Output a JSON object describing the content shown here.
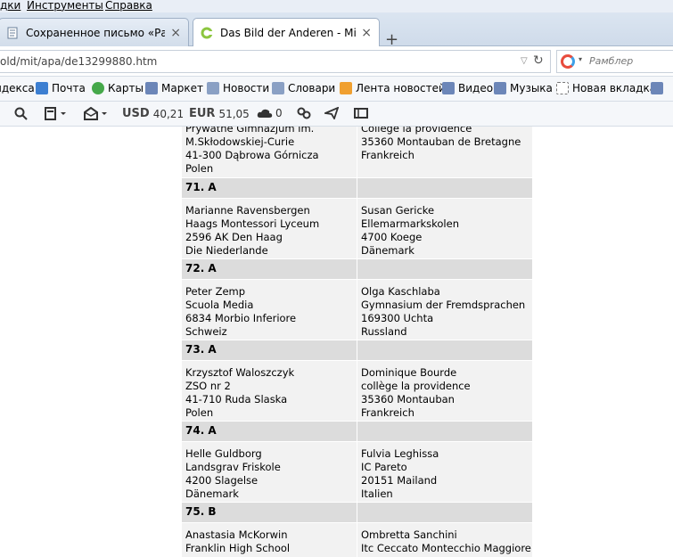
{
  "menubar": {
    "items": [
      "дки",
      "Инструменты",
      "Справка"
    ]
  },
  "tabs": [
    {
      "title": "Сохраненное письмо «Ра...",
      "close": "×"
    },
    {
      "title": "Das Bild der Anderen - Mit...",
      "close": "×"
    }
  ],
  "newtab_label": "+",
  "address": {
    "url": "old/mit/apa/de13299880.htm",
    "dropdown": "▽",
    "reload": "↻"
  },
  "search": {
    "placeholder": "Рамблер",
    "arrow": "▾"
  },
  "bookmarks": [
    {
      "label": "ндекса",
      "color": "#d9d9d9"
    },
    {
      "label": "Почта",
      "color": "#3d7fd1"
    },
    {
      "label": "Карты",
      "color": "#45a84a"
    },
    {
      "label": "Маркет",
      "color": "#6c86b8"
    },
    {
      "label": "Новости",
      "color": "#8aa0c4"
    },
    {
      "label": "Словари",
      "color": "#8aa0c4"
    },
    {
      "label": "Лента новостей",
      "color": "#f0a030"
    },
    {
      "label": "Видео",
      "color": "#6c86b8"
    },
    {
      "label": "Музыка",
      "color": "#6c86b8"
    },
    {
      "label": "Новая вкладка",
      "color": "#ffffff"
    }
  ],
  "toolbar": {
    "usd_label": "USD",
    "usd_value": "40,21",
    "eur_label": "EUR",
    "eur_value": "51,05",
    "weather_value": "0"
  },
  "entries": [
    {
      "header": null,
      "left": [
        "Prywatne Gimnazjum im.",
        "M.Skłodowskiej-Curie",
        "41-300 Dąbrowa Górnicza",
        "Polen"
      ],
      "right": [
        "College la providence",
        "35360 Montauban de Bretagne",
        "Frankreich"
      ]
    },
    {
      "header": "71. A",
      "left": [
        "Marianne Ravensbergen",
        "Haags Montessori Lyceum",
        "2596 AK Den Haag",
        "Die Niederlande"
      ],
      "right": [
        "Susan Gericke",
        "Ellemarmarkskolen",
        "4700 Koege",
        "Dänemark"
      ]
    },
    {
      "header": "72. A",
      "left": [
        "Peter Zemp",
        "Scuola Media",
        "6834 Morbio Inferiore",
        "Schweiz"
      ],
      "right": [
        "Olga Kaschlaba",
        "Gymnasium der Fremdsprachen",
        "169300 Uchta",
        "Russland"
      ]
    },
    {
      "header": "73. A",
      "left": [
        "Krzysztof Waloszczyk",
        "ZSO nr 2",
        "41-710 Ruda Slaska",
        "Polen"
      ],
      "right": [
        "Dominique Bourde",
        "collège la providence",
        "35360 Montauban",
        "Frankreich"
      ]
    },
    {
      "header": "74. A",
      "left": [
        "Helle Guldborg",
        "Landsgrav Friskole",
        "4200 Slagelse",
        "Dänemark"
      ],
      "right": [
        "Fulvia Leghissa",
        "IC Pareto",
        "20151 Mailand",
        "Italien"
      ]
    },
    {
      "header": "75. B",
      "left": [
        "Anastasia McKorwin",
        "Franklin High School"
      ],
      "right": [
        "Ombretta Sanchini",
        "Itc Ceccato Montecchio Maggiore"
      ]
    }
  ]
}
